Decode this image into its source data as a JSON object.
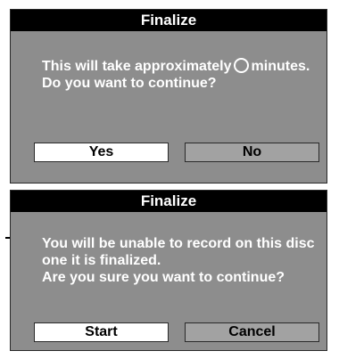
{
  "dialog1": {
    "title": "Finalize",
    "message_line1_pre": "This will take approximately",
    "message_line1_post": "minutes.",
    "message_line2": "Do you want to continue?",
    "yes_label": "Yes",
    "no_label": "No"
  },
  "dialog2": {
    "title": "Finalize",
    "message_line1": "You will be unable to record on this disc",
    "message_line2": "one it is finalized.",
    "message_line3": "Are you sure you want to continue?",
    "start_label": "Start",
    "cancel_label": "Cancel"
  },
  "colors": {
    "dialog_background": "#8d8d8d",
    "title_bar": "#000000",
    "selected_button": "#ffffff",
    "unselected_button": "#a2a2a2",
    "message_text": "#ffffff"
  },
  "icons": {
    "minutes_placeholder": "circle-icon"
  }
}
